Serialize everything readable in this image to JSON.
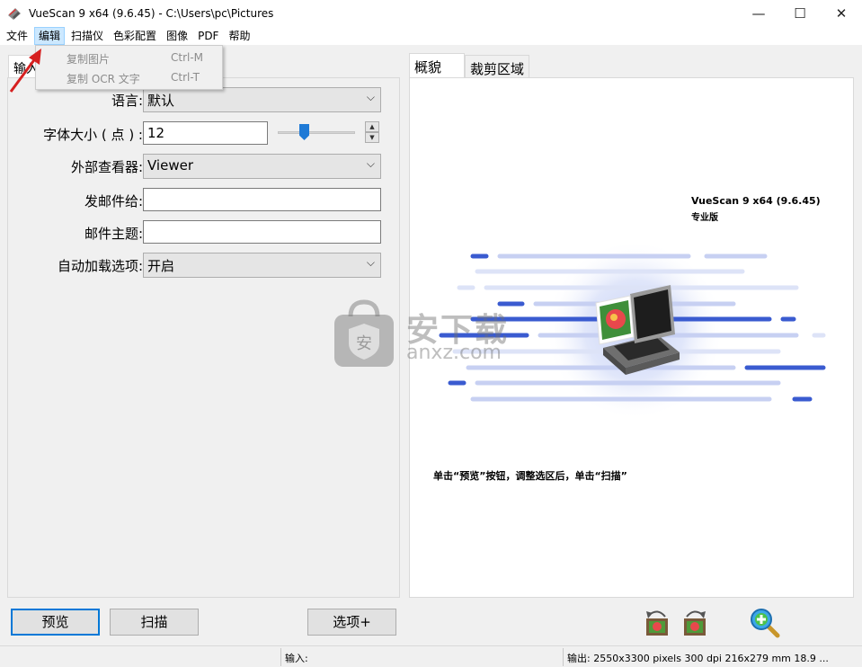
{
  "window": {
    "title": "VueScan 9 x64 (9.6.45) - C:\\Users\\pc\\Pictures",
    "minimize_glyph": "—",
    "maximize_glyph": "☐",
    "close_glyph": "✕"
  },
  "menubar": {
    "items": [
      "文件",
      "编辑",
      "扫描仪",
      "色彩配置",
      "图像",
      "PDF",
      "帮助"
    ],
    "active_index": 1
  },
  "edit_menu": {
    "items": [
      {
        "label": "复制图片",
        "shortcut": "Ctrl-M"
      },
      {
        "label": "复制 OCR 文字",
        "shortcut": "Ctrl-T"
      }
    ]
  },
  "left_panel": {
    "tab": "输入",
    "fields": {
      "language": {
        "label": "语言:",
        "value": "默认"
      },
      "font_size": {
        "label": "字体大小 ( 点 ) :",
        "value": "12",
        "slider_fraction": 0.3
      },
      "viewer": {
        "label": "外部查看器:",
        "value": "Viewer"
      },
      "mail_to": {
        "label": "发邮件给:",
        "value": ""
      },
      "mail_subject": {
        "label": "邮件主题:",
        "value": ""
      },
      "autoload": {
        "label": "自动加载选项:",
        "value": "开启"
      }
    }
  },
  "right_panel": {
    "tabs": [
      "概貌",
      "裁剪区域"
    ],
    "active_tab": 0,
    "promo_title": "VueScan 9 x64 (9.6.45)",
    "promo_edition": "专业版",
    "hint": "单击“预览”按钮，调整选区后，单击“扫描”"
  },
  "watermark": {
    "text": "安下载",
    "sub": "anxz.com",
    "badge": "安"
  },
  "buttons": {
    "preview": "预览",
    "scan": "扫描",
    "options": "选项+"
  },
  "toolbar_icons": [
    "rotate-left-icon",
    "rotate-right-icon",
    "zoom-in-icon"
  ],
  "statusbar": {
    "left": "",
    "input": "输入:",
    "output": "输出: 2550x3300 pixels 300 dpi 216x279 mm 18.9 ..."
  },
  "colors": {
    "accent": "#0078d7",
    "brand_blue": "#3a5bd0",
    "menu_highlight": "#cce8ff",
    "arrow_red": "#d62020"
  }
}
